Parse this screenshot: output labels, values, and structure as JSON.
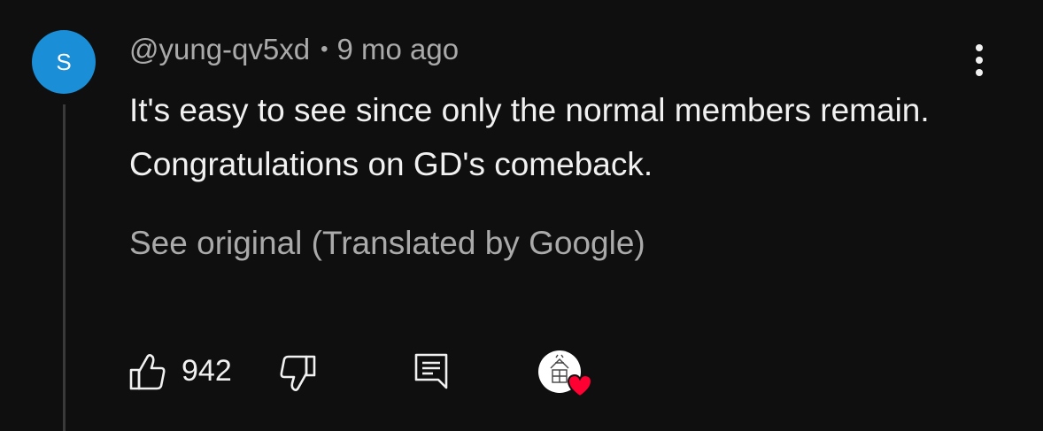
{
  "comment": {
    "avatar_letter": "S",
    "avatar_color": "#1b8ed8",
    "author_handle": "@yung-qv5xd",
    "separator": "•",
    "timestamp": "9 mo ago",
    "text": "It's easy to see since only the normal members remain. Congratulations on GD's comeback.",
    "see_original": "See original (Translated by Google)",
    "more_icon": "more-vertical-icon"
  },
  "actions": {
    "like_icon": "thumbs-up-icon",
    "like_count": "942",
    "dislike_icon": "thumbs-down-icon",
    "reply_icon": "reply-comment-icon",
    "creator_heart": {
      "icon": "creator-heart-icon",
      "heart_color": "#ff0033"
    }
  }
}
